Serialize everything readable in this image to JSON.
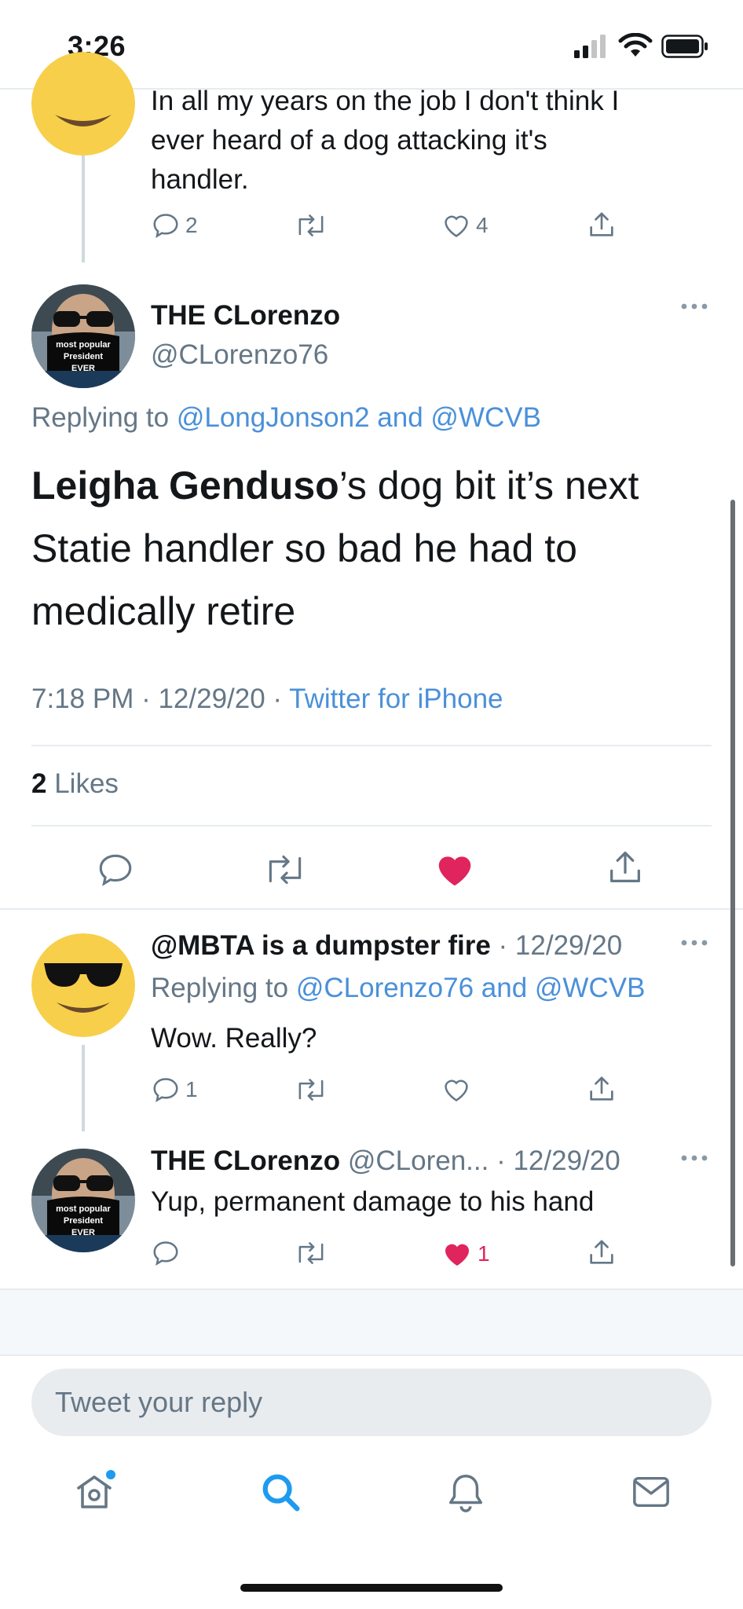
{
  "status_bar": {
    "time": "3:26"
  },
  "top_tweet": {
    "text_line1": "In all my years on the job I don't think I",
    "text_line2": "ever heard of a dog attacking it's",
    "text_line3": "handler.",
    "replies": "2",
    "likes": "4"
  },
  "main_tweet": {
    "display_name": "THE CLorenzo",
    "handle": "@CLorenzo76",
    "avatar_caption_1": "most popular",
    "avatar_caption_2": "President",
    "avatar_caption_3": "EVER",
    "replying_prefix": "Replying to",
    "replying_targets": "@LongJonson2 and @WCVB",
    "text_bold": "Leigha Genduso",
    "text_line1_rest": "’s dog bit it’s next",
    "text_line2": "Statie handler so bad he had to",
    "text_line3": "medically retire",
    "timestamp": "7:18 PM · 12/29/20 · ",
    "source": "Twitter for iPhone",
    "likes_count": "2",
    "likes_label": "Likes"
  },
  "reply1": {
    "display_name": "@MBTA is a dumpster fire",
    "date": "· 12/29/20",
    "replying_prefix": "Replying to",
    "replying_targets": "@CLorenzo76 and @WCVB",
    "text": "Wow. Really?",
    "replies": "1"
  },
  "reply2": {
    "display_name": "THE CLorenzo",
    "handle": "@CLoren...",
    "date": "· 12/29/20",
    "text": "Yup, permanent damage to his hand",
    "likes": "1"
  },
  "compose": {
    "placeholder": "Tweet your reply"
  },
  "colors": {
    "accent": "#1d9bf0",
    "like": "#e0245e",
    "muted": "#657786"
  },
  "tab_bar": {
    "items": [
      "home-icon",
      "search-icon",
      "bell-icon",
      "mail-icon"
    ]
  }
}
